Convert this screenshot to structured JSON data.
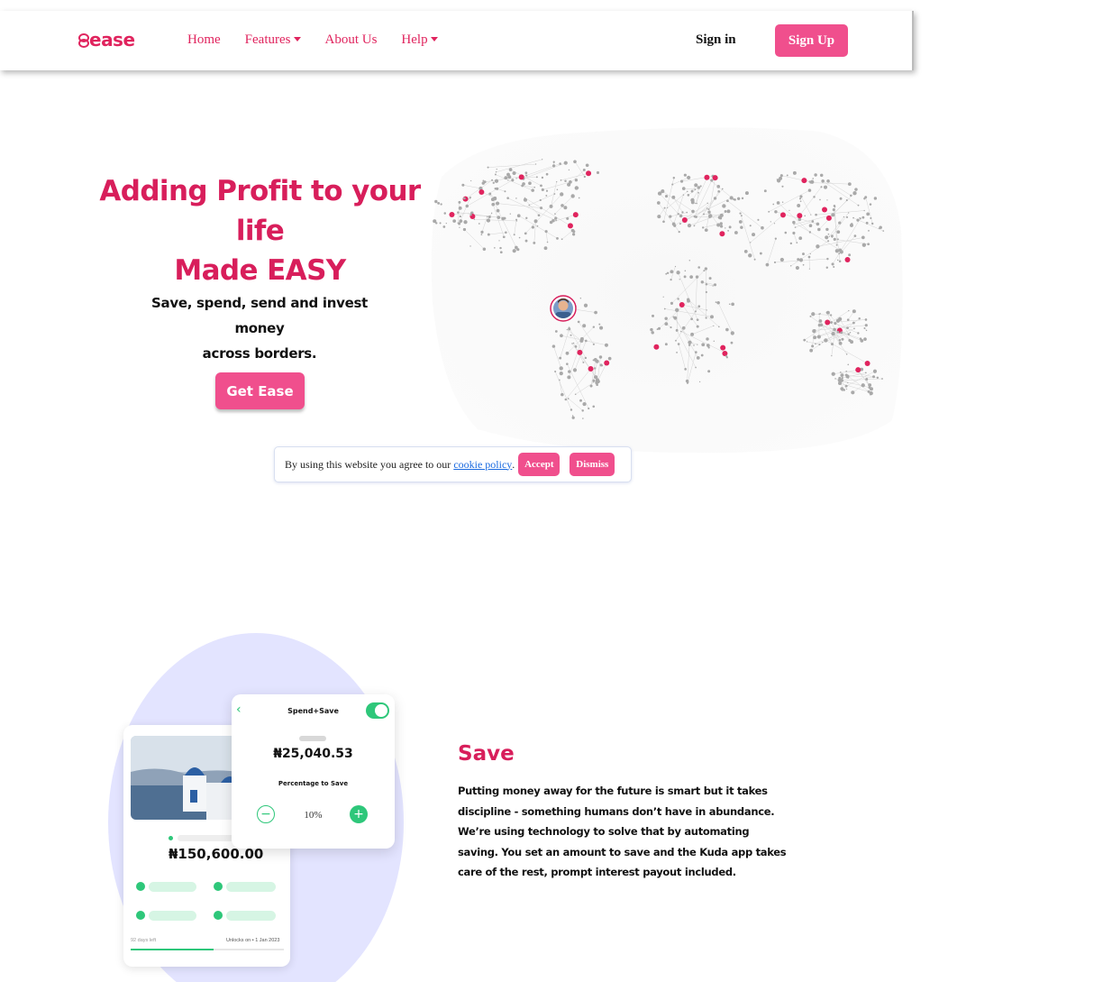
{
  "nav": {
    "logo": "ease",
    "links": [
      {
        "label": "Home",
        "dropdown": false
      },
      {
        "label": "Features",
        "dropdown": true
      },
      {
        "label": "About Us",
        "dropdown": false
      },
      {
        "label": "Help",
        "dropdown": true
      }
    ],
    "sign_in": "Sign in",
    "sign_up": "Sign Up"
  },
  "hero": {
    "title_line1": "Adding Profit to your life",
    "title_line2": "Made EASY",
    "subtitle_line1": "Save, spend, send and invest money",
    "subtitle_line2": "across borders.",
    "cta": "Get Ease"
  },
  "cookie": {
    "text": "By using this website you agree to our",
    "link": "cookie policy",
    "accept": "Accept",
    "dismiss": "Dismiss"
  },
  "save_section": {
    "phone": {
      "amount": "₦150,600.00",
      "days_left": "92 days left",
      "unlocks": "Unlocks on • 1 Jan 2023"
    },
    "card": {
      "title": "Spend+Save",
      "amount": "₦25,040.53",
      "label": "Percentage to Save",
      "value": "10%",
      "minus": "−",
      "plus": "+"
    },
    "title": "Save",
    "text": "Putting money away for the future is smart but it takes discipline - something humans don’t have in abundance. We’re using technology to solve that by automating saving. You set an amount to save and the Kuda app takes care of the rest, prompt interest payout included."
  },
  "colors": {
    "brand": "#e0245e",
    "button": "#f04f8d",
    "accent_green": "#2ec77a",
    "circle": "#e3e4ff"
  }
}
